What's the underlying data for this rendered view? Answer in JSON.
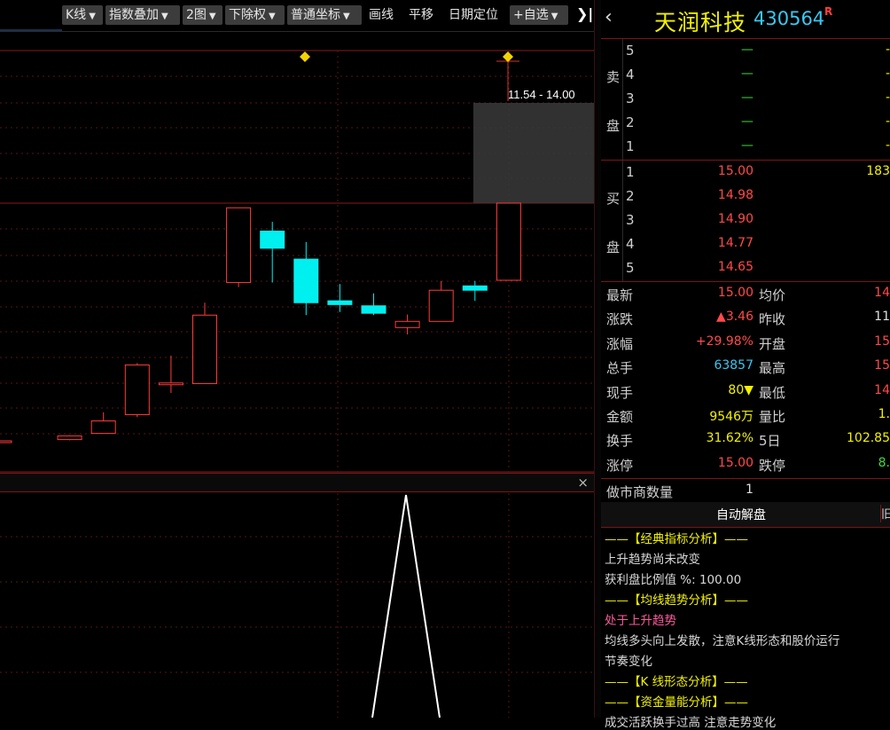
{
  "toolbar": {
    "kline": "K线",
    "index_overlay": "指数叠加",
    "chart_count": "2图",
    "adjust": "下除权",
    "coord": "普通坐标",
    "draw": "画线",
    "pan": "平移",
    "date_locate": "日期定位",
    "watchlist": "+自选",
    "fold": "❯|"
  },
  "chart": {
    "range_label": "11.54 - 14.00",
    "close_icon": "×"
  },
  "candles": [
    {
      "o": 7.32,
      "c": 7.36,
      "h": 7.38,
      "l": 7.3,
      "up": true
    },
    {
      "o": 7.4,
      "c": 7.52,
      "h": 7.54,
      "l": 7.38,
      "up": true
    },
    {
      "o": 7.6,
      "c": 8.0,
      "h": 8.28,
      "l": 7.6,
      "up": true
    },
    {
      "o": 8.2,
      "c": 9.8,
      "h": 9.86,
      "l": 8.12,
      "up": true
    },
    {
      "o": 9.22,
      "c": 9.22,
      "h": 10.1,
      "l": 8.9,
      "up": true
    },
    {
      "o": 9.2,
      "c": 11.4,
      "h": 11.8,
      "l": 9.2,
      "up": true
    },
    {
      "o": 12.45,
      "c": 14.85,
      "h": 14.85,
      "l": 12.3,
      "up": true
    },
    {
      "o": 14.1,
      "c": 13.55,
      "h": 14.4,
      "l": 12.45,
      "up": false
    },
    {
      "o": 13.2,
      "c": 11.8,
      "h": 13.75,
      "l": 11.4,
      "up": false
    },
    {
      "o": 11.86,
      "c": 11.74,
      "h": 12.4,
      "l": 11.5,
      "up": false
    },
    {
      "o": 11.7,
      "c": 11.46,
      "h": 12.1,
      "l": 11.4,
      "up": false
    },
    {
      "o": 11.0,
      "c": 11.2,
      "h": 11.42,
      "l": 10.78,
      "up": true
    },
    {
      "o": 11.2,
      "c": 12.2,
      "h": 12.5,
      "l": 11.2,
      "up": true
    },
    {
      "o": 12.34,
      "c": 12.2,
      "h": 12.5,
      "l": 11.86,
      "up": false
    },
    {
      "o": 12.52,
      "c": 15.0,
      "h": 15.0,
      "l": 12.52,
      "up": true
    }
  ],
  "stock": {
    "name": "天润科技",
    "code": "430564",
    "flag": "R"
  },
  "orderbook": {
    "sell_side": [
      "卖",
      "盘"
    ],
    "buy_side": [
      "买",
      "盘"
    ],
    "sells": [
      {
        "level": "5",
        "price": "—",
        "vol": "-"
      },
      {
        "level": "4",
        "price": "—",
        "vol": "-"
      },
      {
        "level": "3",
        "price": "—",
        "vol": "-"
      },
      {
        "level": "2",
        "price": "—",
        "vol": "-"
      },
      {
        "level": "1",
        "price": "—",
        "vol": "-"
      }
    ],
    "buys": [
      {
        "level": "1",
        "price": "15.00",
        "vol": "183"
      },
      {
        "level": "2",
        "price": "14.98",
        "vol": ""
      },
      {
        "level": "3",
        "price": "14.90",
        "vol": ""
      },
      {
        "level": "4",
        "price": "14.77",
        "vol": ""
      },
      {
        "level": "5",
        "price": "14.65",
        "vol": ""
      }
    ]
  },
  "quote": {
    "rows": [
      {
        "l1": "最新",
        "v1": "15.00",
        "c1": "#ff4a4a",
        "l2": "均价",
        "v2": "14",
        "c2": "#ff4a4a"
      },
      {
        "l1": "涨跌",
        "v1": "▲3.46",
        "c1": "#ff4a4a",
        "l2": "昨收",
        "v2": "11",
        "c2": "#e0e0e0"
      },
      {
        "l1": "涨幅",
        "v1": "+29.98%",
        "c1": "#ff4a4a",
        "l2": "开盘",
        "v2": "15",
        "c2": "#ff4a4a"
      },
      {
        "l1": "总手",
        "v1": "63857",
        "c1": "#39c8f0",
        "l2": "最高",
        "v2": "15",
        "c2": "#ff4a4a"
      },
      {
        "l1": "现手",
        "v1": "80▼",
        "c1": "#f2f200",
        "l2": "最低",
        "v2": "14",
        "c2": "#ff4a4a"
      },
      {
        "l1": "金额",
        "v1": "9546万",
        "c1": "#f2f200",
        "l2": "量比",
        "v2": "1.",
        "c2": "#f2f200"
      },
      {
        "l1": "换手",
        "v1": "31.62%",
        "c1": "#f2f200",
        "l2": "5日",
        "v2": "102.85",
        "c2": "#f2f200"
      },
      {
        "l1": "涨停",
        "v1": "15.00",
        "c1": "#ff4a4a",
        "l2": "跌停",
        "v2": "8.",
        "c2": "#3cdc3c"
      }
    ],
    "market_maker_label": "做市商数量",
    "market_maker_value": "1"
  },
  "auto_analysis": {
    "title": "自动解盘",
    "side_char": "旧",
    "lines": [
      {
        "text": "——【经典指标分析】——",
        "color": "#f2f200"
      },
      {
        "text": "上升趋势尚未改变",
        "color": "#d8d8d8"
      },
      {
        "text": "获利盘比例值 %: 100.00",
        "color": "#d8d8d8"
      },
      {
        "text": "——【均线趋势分析】——",
        "color": "#f2f200"
      },
      {
        "text": "处于上升趋势",
        "color": "#ff5aa0"
      },
      {
        "text": "均线多头向上发散，注意K线形态和股价运行",
        "color": "#d8d8d8"
      },
      {
        "text": "节奏变化",
        "color": "#d8d8d8"
      },
      {
        "text": "——【K 线形态分析】——",
        "color": "#f2f200"
      },
      {
        "text": "——【资金量能分析】——",
        "color": "#f2f200"
      },
      {
        "text": "成交活跃换手过高 注意走势变化",
        "color": "#d8d8d8"
      }
    ]
  }
}
